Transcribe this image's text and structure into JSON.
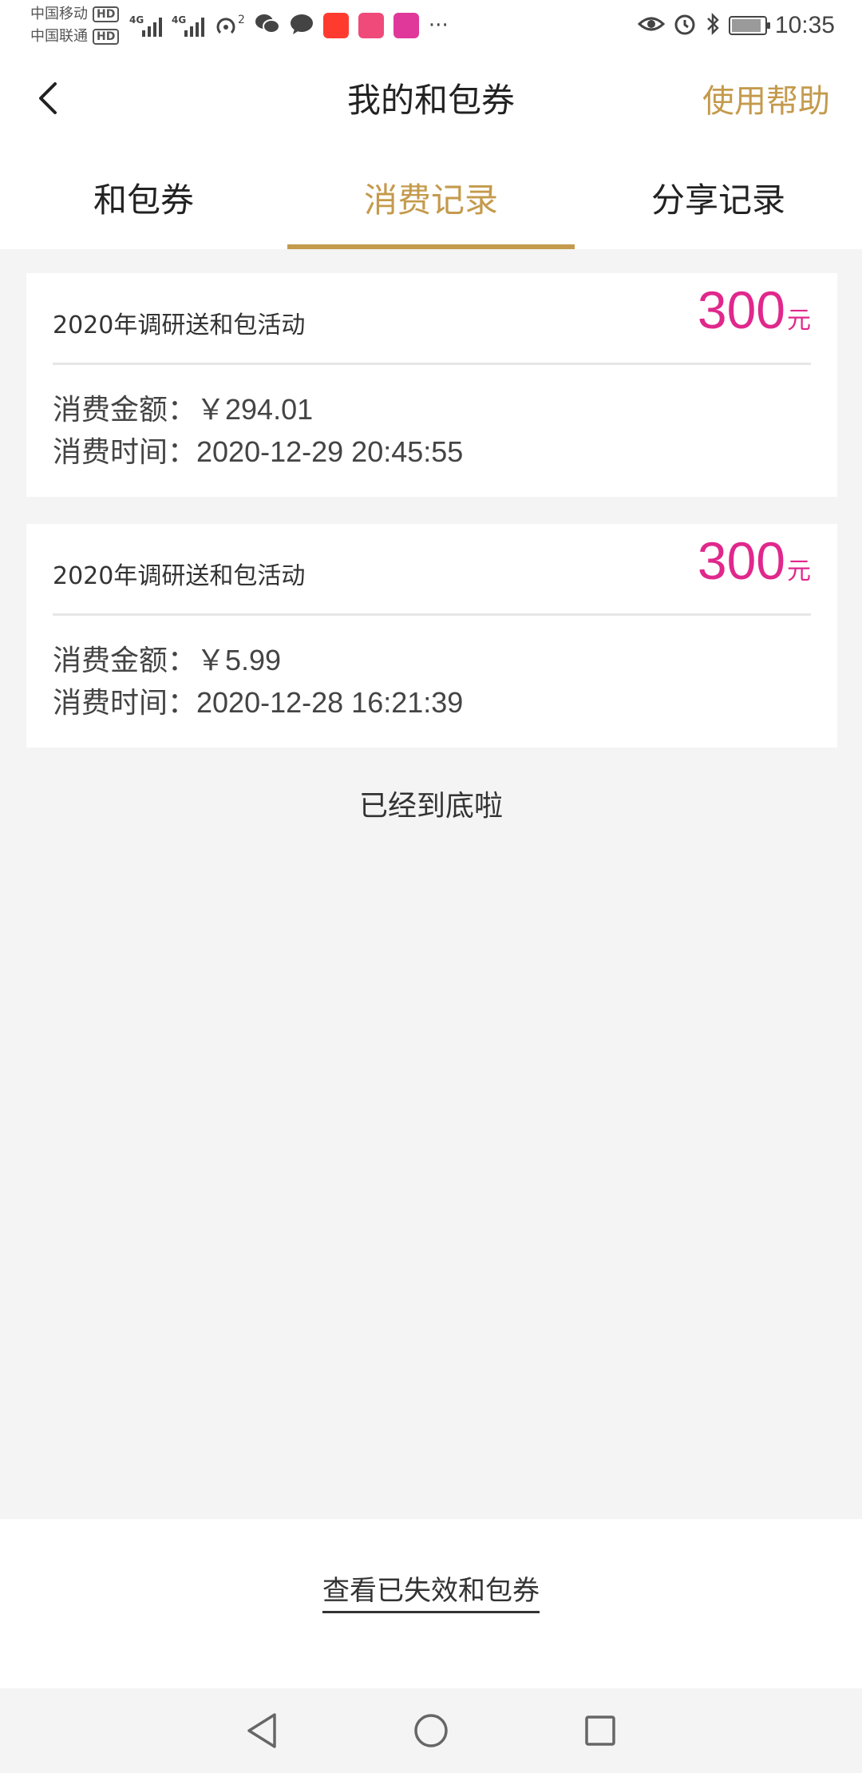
{
  "status_bar": {
    "carriers": [
      "中国移动",
      "中国联通"
    ],
    "hd_label": "HD",
    "network": "4G",
    "hotspot_count": "2",
    "more": "···",
    "time": "10:35",
    "app_badges": [
      {
        "name": "app-badge-1",
        "color": "#ff3b30"
      },
      {
        "name": "app-badge-2",
        "color": "#f04a7a"
      },
      {
        "name": "app-badge-3",
        "color": "#e0389a"
      }
    ]
  },
  "header": {
    "title": "我的和包券",
    "help": "使用帮助",
    "back_icon": "chevron-left-icon"
  },
  "tabs": [
    {
      "label": "和包券",
      "active": false
    },
    {
      "label": "消费记录",
      "active": true
    },
    {
      "label": "分享记录",
      "active": false
    }
  ],
  "records": [
    {
      "name": "2020年调研送和包活动",
      "amount": "300",
      "unit": "元",
      "spent_label": "消费金额：",
      "spent_value": "￥294.01",
      "time_label": "消费时间：",
      "time_value": "2020-12-29 20:45:55"
    },
    {
      "name": "2020年调研送和包活动",
      "amount": "300",
      "unit": "元",
      "spent_label": "消费金额：",
      "spent_value": "￥5.99",
      "time_label": "消费时间：",
      "time_value": "2020-12-28 16:21:39"
    }
  ],
  "end_text": "已经到底啦",
  "expired_link": "查看已失效和包券",
  "colors": {
    "accent": "#c49a4c",
    "amount": "#e0288c"
  }
}
